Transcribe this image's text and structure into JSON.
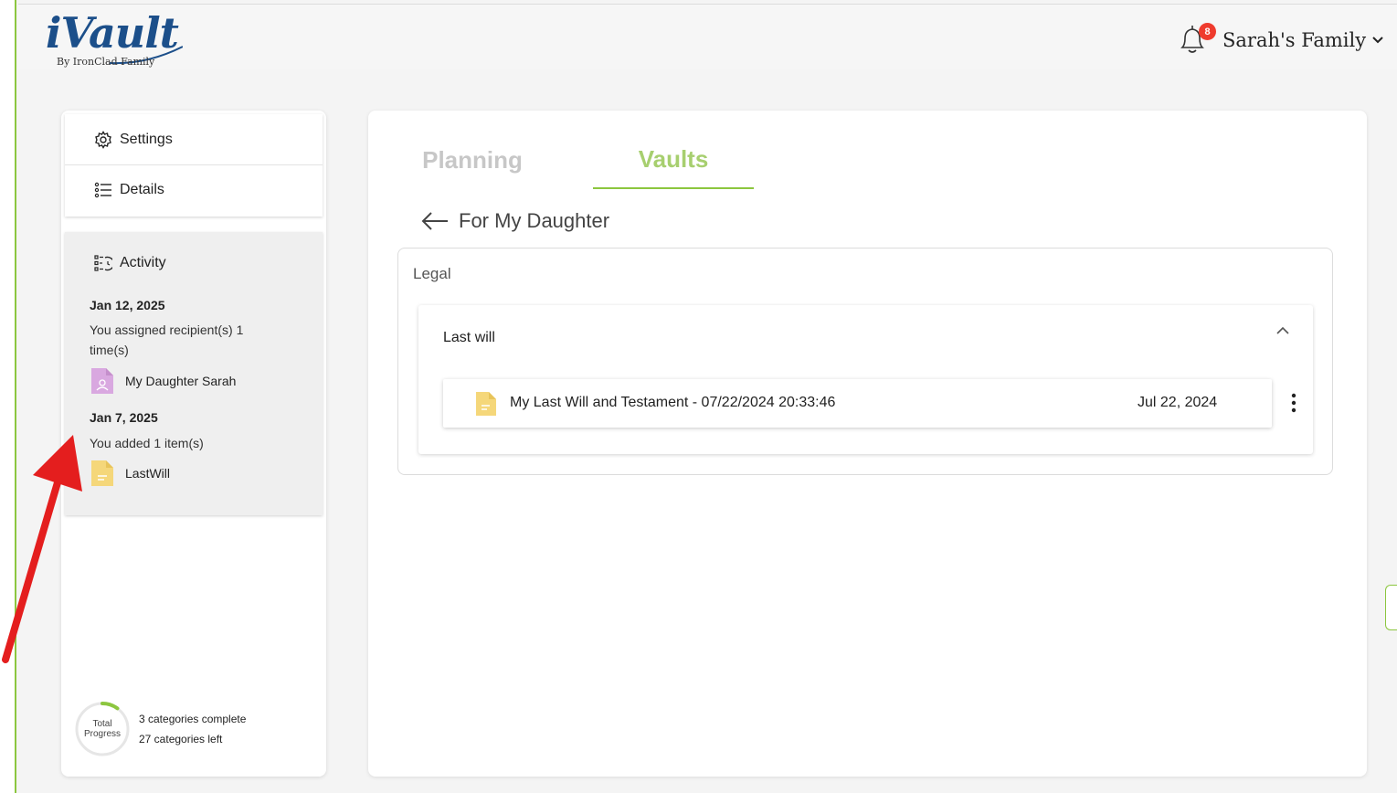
{
  "header": {
    "logo_main": "iVault",
    "logo_sub": "By IronClad Family",
    "notification_count": "8",
    "family_name": "Sarah's Family"
  },
  "sidebar": {
    "menu": [
      {
        "label": "Settings",
        "icon": "gear-icon"
      },
      {
        "label": "Details",
        "icon": "list-icon"
      }
    ],
    "activity": {
      "title": "Activity",
      "entries": [
        {
          "date": "Jan 12, 2025",
          "text": "You assigned recipient(s) 1 time(s)",
          "file": "My Daughter Sarah",
          "file_icon": "contact-file-icon"
        },
        {
          "date": "Jan 7, 2025",
          "text": "You added 1 item(s)",
          "file": "LastWill",
          "file_icon": "document-file-icon"
        }
      ]
    },
    "progress": {
      "label_line1": "Total",
      "label_line2": "Progress",
      "complete": "3 categories complete",
      "left": "27 categories left",
      "fraction": 0.1
    }
  },
  "main": {
    "tabs": [
      {
        "label": "Planning",
        "active": false
      },
      {
        "label": "Vaults",
        "active": true
      }
    ],
    "back_title": "For My Daughter",
    "section": {
      "title": "Legal",
      "group": {
        "title": "Last will",
        "items": [
          {
            "name": "My Last Will and Testament - 07/22/2024 20:33:46",
            "date": "Jul 22, 2024"
          }
        ]
      }
    }
  },
  "colors": {
    "brand_blue": "#1c4f8a",
    "accent_green": "#8cc63f",
    "badge_red": "#ef3b2d",
    "doc_yellow": "#f5d77a",
    "contact_purple": "#d9a8e0"
  }
}
